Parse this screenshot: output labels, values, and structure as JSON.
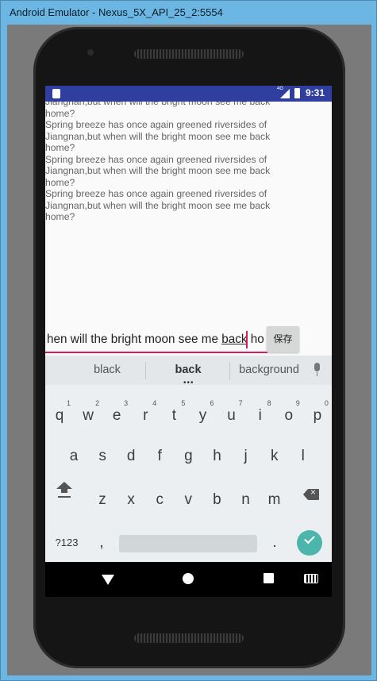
{
  "window": {
    "title": "Android Emulator - Nexus_5X_API_25_2:5554"
  },
  "status_bar": {
    "time": "9:31",
    "network": "4G"
  },
  "content": {
    "poem_text": "Jiangnan,but when will the bright moon see me back home?\nSpring breeze has once again greened riversides of Jiangnan,but when will the bright moon see me back home?\nSpring breeze has once again greened riversides of Jiangnan,but when will the bright moon see me back home?\nSpring breeze has once again greened riversides of Jiangnan,but when will the bright moon see me back home?"
  },
  "edit": {
    "text_before": "hen will the bright moon see me ",
    "text_underlined": "back",
    "text_after": " ho"
  },
  "save_button": {
    "label": "保存"
  },
  "keyboard": {
    "suggestions": [
      "black",
      "back",
      "background"
    ],
    "row1": [
      {
        "key": "q",
        "hint": "1"
      },
      {
        "key": "w",
        "hint": "2"
      },
      {
        "key": "e",
        "hint": "3"
      },
      {
        "key": "r",
        "hint": "4"
      },
      {
        "key": "t",
        "hint": "5"
      },
      {
        "key": "y",
        "hint": "6"
      },
      {
        "key": "u",
        "hint": "7"
      },
      {
        "key": "i",
        "hint": "8"
      },
      {
        "key": "o",
        "hint": "9"
      },
      {
        "key": "p",
        "hint": "0"
      }
    ],
    "row2": [
      "a",
      "s",
      "d",
      "f",
      "g",
      "h",
      "j",
      "k",
      "l"
    ],
    "row3": [
      "z",
      "x",
      "c",
      "v",
      "b",
      "n",
      "m"
    ],
    "symbols_label": "?123",
    "comma": ",",
    "period": "."
  },
  "icons": {
    "shift": "shift-icon",
    "backspace": "backspace-icon",
    "enter": "check-icon",
    "mic": "mic-icon"
  },
  "colors": {
    "status_bar": "#303f9f",
    "accent": "#d81b60",
    "enter_key": "#4db6ac"
  }
}
